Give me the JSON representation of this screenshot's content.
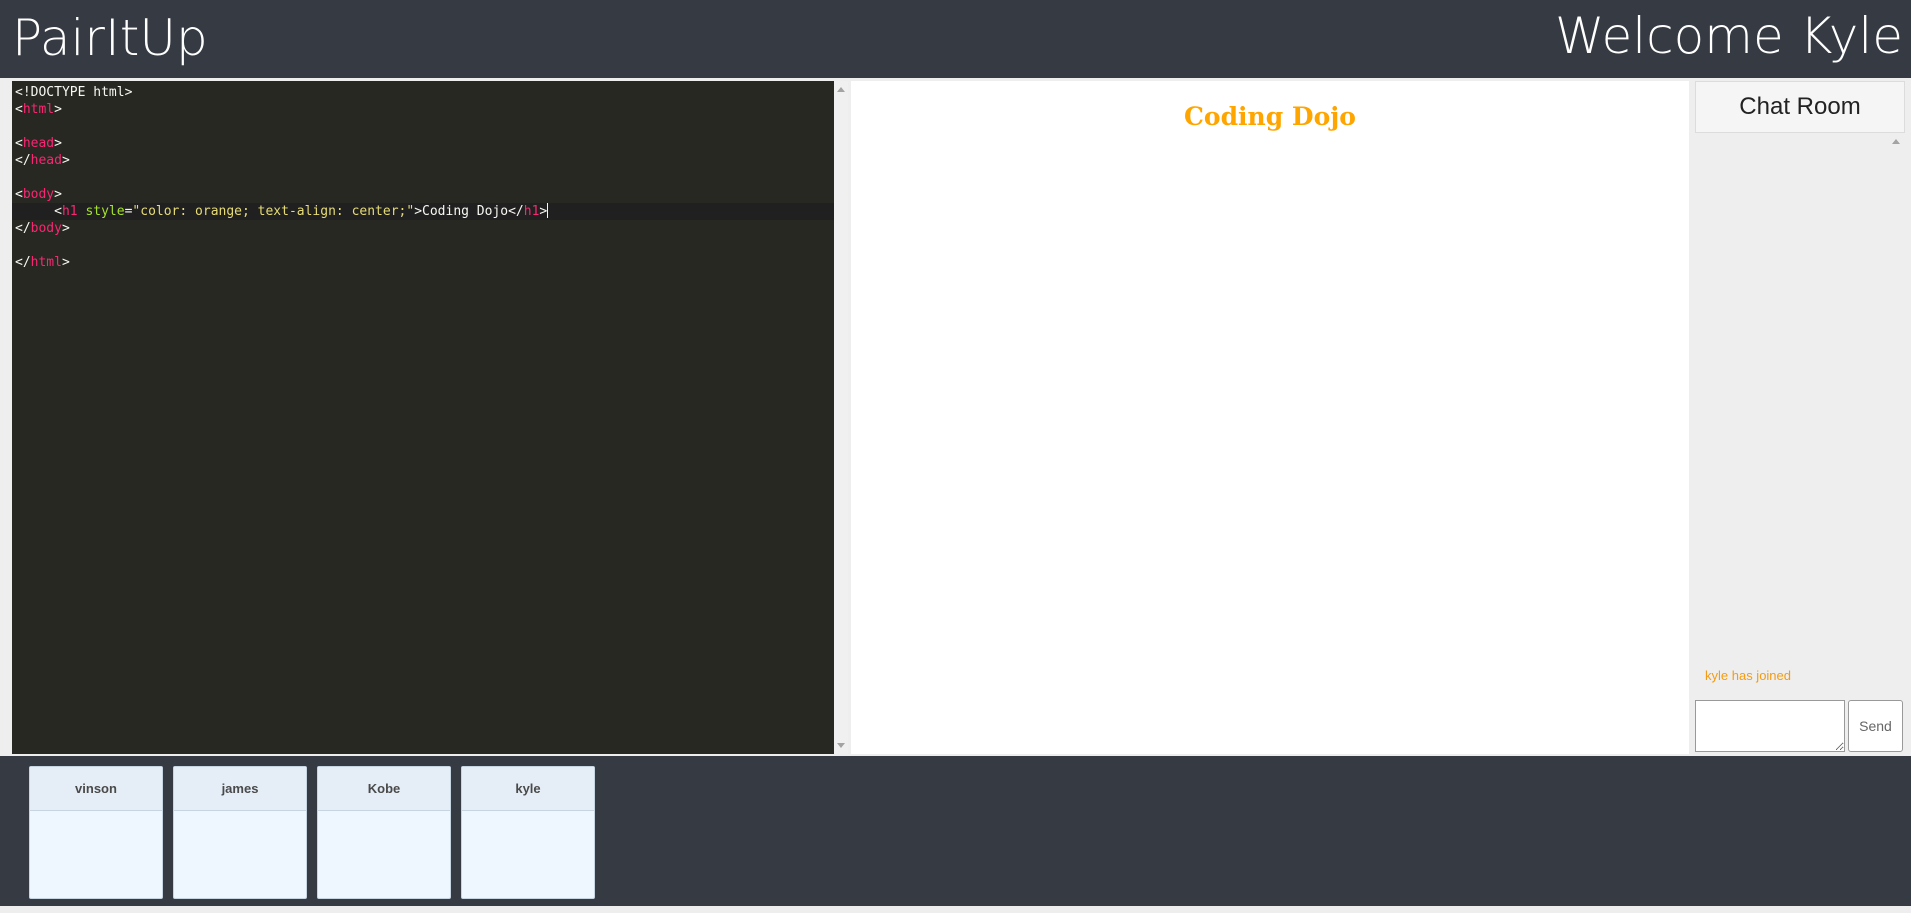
{
  "header": {
    "brand": "PairItUp",
    "welcome": "Welcome Kyle"
  },
  "editor": {
    "lines": [
      [
        {
          "t": "<!DOCTYPE html>",
          "c": "plain"
        }
      ],
      [
        {
          "t": "<",
          "c": "plain"
        },
        {
          "t": "html",
          "c": "tag"
        },
        {
          "t": ">",
          "c": "plain"
        }
      ],
      [],
      [
        {
          "t": "<",
          "c": "plain"
        },
        {
          "t": "head",
          "c": "tag"
        },
        {
          "t": ">",
          "c": "plain"
        }
      ],
      [
        {
          "t": "</",
          "c": "plain"
        },
        {
          "t": "head",
          "c": "tag"
        },
        {
          "t": ">",
          "c": "plain"
        }
      ],
      [],
      [
        {
          "t": "<",
          "c": "plain"
        },
        {
          "t": "body",
          "c": "tag"
        },
        {
          "t": ">",
          "c": "plain"
        }
      ],
      [
        {
          "t": "     <",
          "c": "plain"
        },
        {
          "t": "h1",
          "c": "tag"
        },
        {
          "t": " ",
          "c": "plain"
        },
        {
          "t": "style",
          "c": "attr"
        },
        {
          "t": "=",
          "c": "plain"
        },
        {
          "t": "\"color: orange; text-align: center;\"",
          "c": "str"
        },
        {
          "t": ">Coding Dojo</",
          "c": "plain"
        },
        {
          "t": "h1",
          "c": "tag"
        },
        {
          "t": ">",
          "c": "plain"
        }
      ],
      [
        {
          "t": "</",
          "c": "plain"
        },
        {
          "t": "body",
          "c": "tag"
        },
        {
          "t": ">",
          "c": "plain"
        }
      ],
      [],
      [
        {
          "t": "</",
          "c": "plain"
        },
        {
          "t": "html",
          "c": "tag"
        },
        {
          "t": ">",
          "c": "plain"
        }
      ]
    ],
    "active_line": 8,
    "colors": {
      "background": "#272822",
      "plain": "#f8f8f2",
      "tag": "#f92672",
      "attr": "#a6e22e",
      "str": "#e6db74"
    }
  },
  "preview": {
    "heading": "Coding Dojo",
    "heading_color": "#ffa500"
  },
  "chat": {
    "title": "Chat Room",
    "messages": [
      "kyle has joined"
    ],
    "message_color": "#f39c12",
    "input_value": "",
    "send_label": "Send"
  },
  "users": [
    {
      "name": "vinson"
    },
    {
      "name": "james"
    },
    {
      "name": "Kobe"
    },
    {
      "name": "kyle"
    }
  ],
  "theme": {
    "header_bg": "#353a43",
    "footer_bg": "#353a43"
  }
}
